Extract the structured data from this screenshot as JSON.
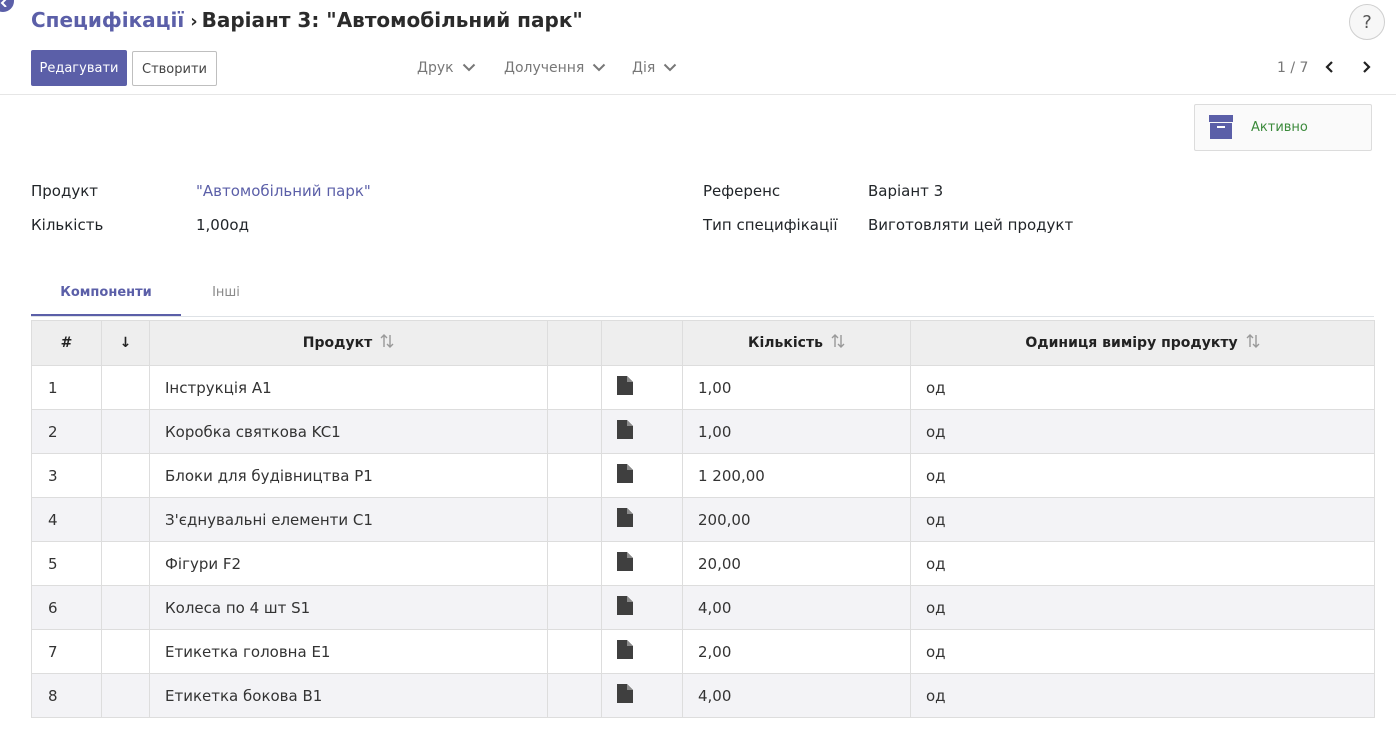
{
  "breadcrumb": {
    "parent": "Специфікації",
    "separator": "›",
    "current": "Варіант 3: \"Автомобільний парк\""
  },
  "help_label": "?",
  "toolbar": {
    "edit_label": "Редагувати",
    "create_label": "Створити",
    "print_label": "Друк",
    "attachments_label": "Долучення",
    "action_label": "Дія"
  },
  "pager": {
    "value": "1 / 7"
  },
  "archive": {
    "label": "Активно",
    "icon": "archive-icon",
    "color": "#3b8a3b"
  },
  "fields": {
    "product_label": "Продукт",
    "product_value": "\"Автомобільний парк\"",
    "quantity_label": "Кількість",
    "quantity_value": "1,00од",
    "reference_label": "Референс",
    "reference_value": "Варіант 3",
    "type_label": "Тип специфікації",
    "type_value": "Виготовляти цей продукт"
  },
  "tabs": [
    {
      "label": "Компоненти",
      "active": true
    },
    {
      "label": "Інші",
      "active": false
    }
  ],
  "table": {
    "headers": [
      "#",
      "↓",
      "Продукт",
      "",
      "",
      "Кількість",
      "Одиниця виміру продукту"
    ],
    "rows": [
      {
        "num": "1",
        "product": "Інструкція A1",
        "qty": "1,00",
        "uom": "од"
      },
      {
        "num": "2",
        "product": "Коробка святкова KC1",
        "qty": "1,00",
        "uom": "од"
      },
      {
        "num": "3",
        "product": "Блоки для будівництва P1",
        "qty": "1 200,00",
        "uom": "од"
      },
      {
        "num": "4",
        "product": "З'єднувальні елементи C1",
        "qty": "200,00",
        "uom": "од"
      },
      {
        "num": "5",
        "product": "Фігури F2",
        "qty": "20,00",
        "uom": "од"
      },
      {
        "num": "6",
        "product": "Колеса по 4 шт S1",
        "qty": "4,00",
        "uom": "од"
      },
      {
        "num": "7",
        "product": "Етикетка головна E1",
        "qty": "2,00",
        "uom": "од"
      },
      {
        "num": "8",
        "product": "Етикетка бокова B1",
        "qty": "4,00",
        "uom": "од"
      }
    ]
  },
  "colors": {
    "brand": "#5b5fa8",
    "active_status": "#3b8a3b"
  }
}
